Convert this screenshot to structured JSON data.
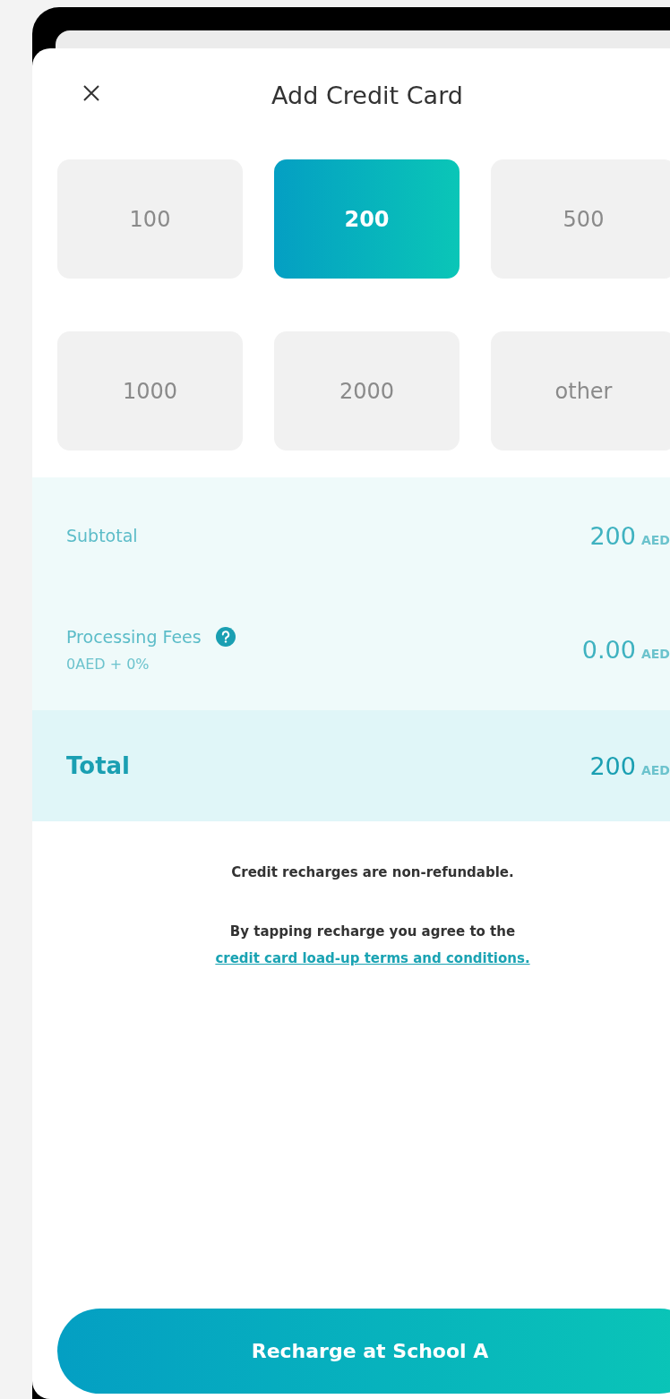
{
  "header": {
    "title": "Add Credit Card"
  },
  "amounts": [
    {
      "label": "100",
      "selected": false
    },
    {
      "label": "200",
      "selected": true
    },
    {
      "label": "500",
      "selected": false
    },
    {
      "label": "1000",
      "selected": false
    },
    {
      "label": "2000",
      "selected": false
    },
    {
      "label": "other",
      "selected": false
    }
  ],
  "summary": [
    {
      "kind": "line",
      "label": "Subtotal",
      "amount": "200",
      "currency": "AED"
    },
    {
      "kind": "fee",
      "label": "Processing Fees",
      "detail": "0AED + 0%",
      "amount": "0.00",
      "currency": "AED"
    },
    {
      "kind": "total",
      "label": "Total",
      "amount": "200",
      "currency": "AED"
    }
  ],
  "notes": {
    "refund": "Credit recharges are non-refundable.",
    "terms": "By tapping recharge you agree to the ",
    "terms_link": "credit card load-up terms and conditions."
  },
  "button": "Recharge at School A"
}
